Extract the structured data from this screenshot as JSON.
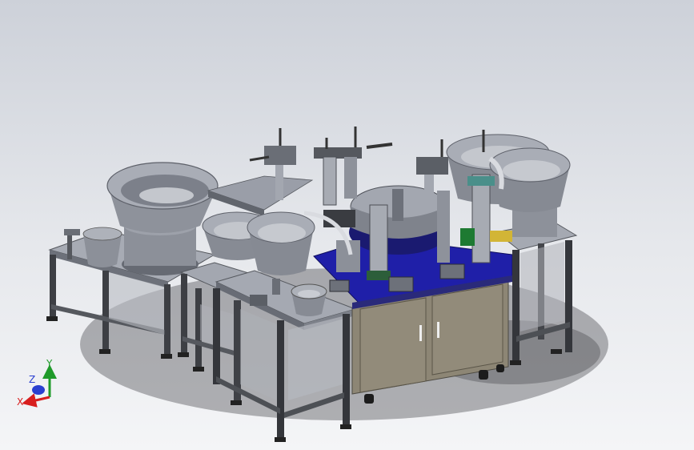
{
  "triad": {
    "x_label": "X",
    "y_label": "Y",
    "z_label": "Z",
    "x_color": "#d81e1e",
    "y_color": "#1f9a2a",
    "z_color": "#2a3fd0"
  },
  "palette": {
    "frame": "#3b3d42",
    "frame_light": "#8e939b",
    "plate": "#9fa3ad",
    "plate_dark": "#6c707a",
    "bowl": "#a9adb6",
    "bowl_inner": "#c9ccd2",
    "base_blue": "#1f1fa5",
    "cabinet": "#8f8877",
    "cabinet_dark": "#6f695b"
  }
}
